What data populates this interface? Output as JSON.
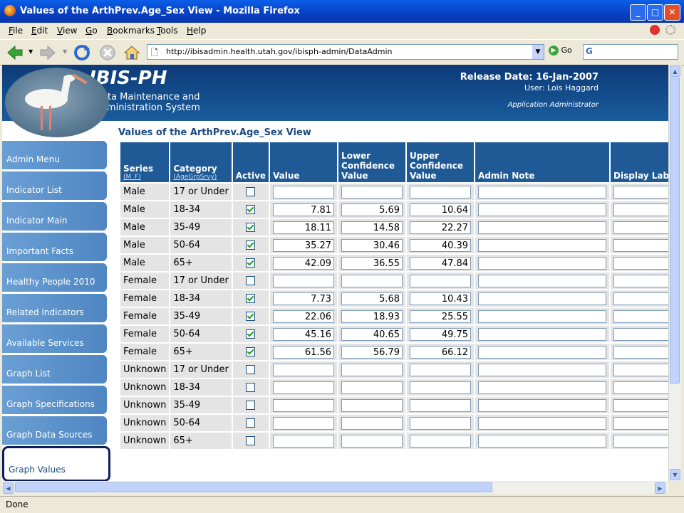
{
  "window": {
    "title": "Values of the ArthPrev.Age_Sex View - Mozilla Firefox"
  },
  "menu": [
    {
      "accel": "F",
      "rest": "ile"
    },
    {
      "accel": "E",
      "rest": "dit"
    },
    {
      "accel": "V",
      "rest": "iew"
    },
    {
      "accel": "G",
      "rest": "o"
    },
    {
      "accel": "B",
      "rest": "ookmarks"
    },
    {
      "accel": "T",
      "rest": "ools"
    },
    {
      "accel": "H",
      "rest": "elp"
    }
  ],
  "nav": {
    "url": "http://ibisadmin.health.utah.gov/ibisph-admin/DataAdmin",
    "go_label": "Go"
  },
  "banner": {
    "logo": "IBIS-PH",
    "subtitle_line1": "Data Maintenance and",
    "subtitle_line2": "Administration System",
    "release": "Release Date: 16-Jan-2007",
    "user": "User: Lois Haggard",
    "role": "Application Administrator"
  },
  "page_title": "Values of the ArthPrev.Age_Sex View",
  "sidebar": [
    "Admin Menu",
    "Indicator List",
    "Indicator Main",
    "Important Facts",
    "Healthy People 2010",
    "Related Indicators",
    "Available Services",
    "Graph List",
    "Graph Specifications",
    "Graph Data Sources",
    "Graph Values"
  ],
  "sidebar_active": "Graph Values",
  "table": {
    "headers": {
      "series": "Series",
      "series_sub": "(M_F)",
      "category": "Category",
      "category_sub": "(AgeGrpSrvy)",
      "active": "Active",
      "value": "Value",
      "lower": "Lower Confidence Value",
      "upper": "Upper Confidence Value",
      "note": "Admin Note",
      "display": "Display Lab"
    },
    "rows": [
      {
        "series": "Male",
        "category": "17 or Under",
        "active": false,
        "value": "",
        "lower": "",
        "upper": ""
      },
      {
        "series": "Male",
        "category": "18-34",
        "active": true,
        "value": "7.81",
        "lower": "5.69",
        "upper": "10.64"
      },
      {
        "series": "Male",
        "category": "35-49",
        "active": true,
        "value": "18.11",
        "lower": "14.58",
        "upper": "22.27"
      },
      {
        "series": "Male",
        "category": "50-64",
        "active": true,
        "value": "35.27",
        "lower": "30.46",
        "upper": "40.39"
      },
      {
        "series": "Male",
        "category": "65+",
        "active": true,
        "value": "42.09",
        "lower": "36.55",
        "upper": "47.84"
      },
      {
        "series": "Female",
        "category": "17 or Under",
        "active": false,
        "value": "",
        "lower": "",
        "upper": ""
      },
      {
        "series": "Female",
        "category": "18-34",
        "active": true,
        "value": "7.73",
        "lower": "5.68",
        "upper": "10.43"
      },
      {
        "series": "Female",
        "category": "35-49",
        "active": true,
        "value": "22.06",
        "lower": "18.93",
        "upper": "25.55"
      },
      {
        "series": "Female",
        "category": "50-64",
        "active": true,
        "value": "45.16",
        "lower": "40.65",
        "upper": "49.75"
      },
      {
        "series": "Female",
        "category": "65+",
        "active": true,
        "value": "61.56",
        "lower": "56.79",
        "upper": "66.12"
      },
      {
        "series": "Unknown",
        "category": "17 or Under",
        "active": false,
        "value": "",
        "lower": "",
        "upper": ""
      },
      {
        "series": "Unknown",
        "category": "18-34",
        "active": false,
        "value": "",
        "lower": "",
        "upper": ""
      },
      {
        "series": "Unknown",
        "category": "35-49",
        "active": false,
        "value": "",
        "lower": "",
        "upper": ""
      },
      {
        "series": "Unknown",
        "category": "50-64",
        "active": false,
        "value": "",
        "lower": "",
        "upper": ""
      },
      {
        "series": "Unknown",
        "category": "65+",
        "active": false,
        "value": "",
        "lower": "",
        "upper": ""
      }
    ]
  },
  "status": "Done",
  "colors": {
    "header_bg": "#1f5a96",
    "nav_bg": "#5b8fc9",
    "cell_bg": "#e4e4e4",
    "title_blue": "#1a4a80"
  }
}
